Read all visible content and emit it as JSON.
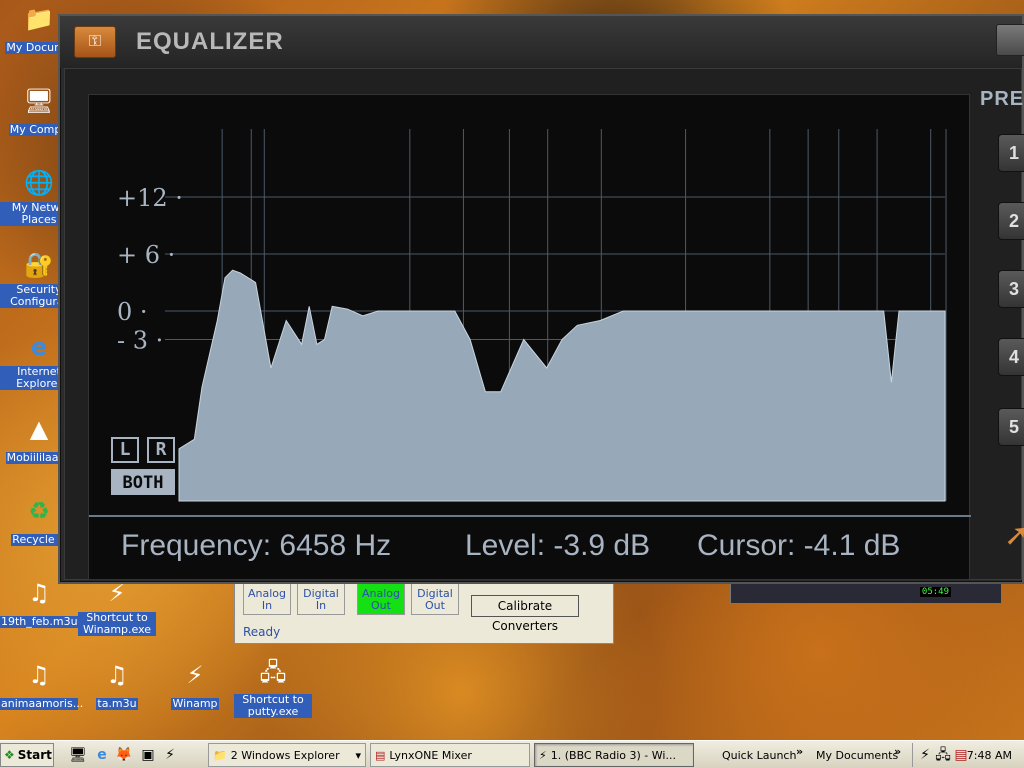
{
  "desktop": {
    "icons": [
      {
        "label": "My Docume",
        "glyph": "📁"
      },
      {
        "label": "My Compu",
        "glyph": "🖥"
      },
      {
        "label": "My Netwo Places",
        "glyph": "🌐"
      },
      {
        "label": "Security Configurat",
        "glyph": "🔐"
      },
      {
        "label": "Internet Explorer",
        "glyph": "e"
      },
      {
        "label": "Mobiililaajal",
        "glyph": "▲"
      },
      {
        "label": "Recycle B",
        "glyph": "♻"
      },
      {
        "label": "19th_feb.m3u",
        "glyph": "♫"
      },
      {
        "label": "Shortcut to Winamp.exe",
        "glyph": "⚡"
      },
      {
        "label": "animaamoris...",
        "glyph": "♫"
      },
      {
        "label": "ta.m3u",
        "glyph": "♫"
      },
      {
        "label": "Winamp",
        "glyph": "⚡"
      },
      {
        "label": "Shortcut to putty.exe",
        "glyph": "🖧"
      }
    ]
  },
  "mixer": {
    "buttons": [
      "Analog In",
      "Digital In",
      "Analog Out",
      "Digital Out"
    ],
    "active_index": 2,
    "calibrate_label": "Calibrate Converters",
    "status": "Ready"
  },
  "winamp_mini": {
    "time": "05:49"
  },
  "equalizer": {
    "title": "EQUALIZER",
    "presets_label": "PRE",
    "preset_buttons": [
      "1",
      "2",
      "3",
      "4",
      "5"
    ],
    "channel_buttons": {
      "left": "L",
      "right": "R",
      "both": "BOTH"
    },
    "active_channel": "both",
    "y_ticks": [
      "+12",
      "+ 6",
      "0",
      "- 3"
    ],
    "readout": {
      "frequency": "Frequency:  6458 Hz",
      "level": "Level: -3.9 dB",
      "cursor": "Cursor: -4.1 dB"
    },
    "colors": {
      "curve": "#97a9b8",
      "grid": "#4c5a68",
      "text": "#a8b4c2",
      "background": "#0b0b0c"
    }
  },
  "chart_data": {
    "type": "area",
    "y_tick_labels": [
      "+12",
      "+ 6",
      "0",
      "- 3"
    ],
    "y_tick_values": [
      12,
      6,
      0,
      -3
    ],
    "ylim": [
      -15,
      15
    ],
    "x": [
      0,
      2,
      3,
      5,
      6,
      7,
      8,
      10,
      12,
      14,
      16,
      17,
      18,
      19,
      20,
      22,
      24,
      26,
      27,
      28,
      30,
      33,
      36,
      38,
      40,
      42,
      45,
      48,
      50,
      52,
      55,
      58,
      60,
      62,
      65,
      70,
      72,
      75,
      80,
      84,
      88,
      90,
      91,
      92,
      93,
      94,
      95,
      97,
      100
    ],
    "values": [
      -14.5,
      -13.5,
      -8,
      -1,
      3.5,
      4.3,
      4,
      3,
      -6,
      -1,
      -3.5,
      0.5,
      -3.5,
      -3,
      0.5,
      0.2,
      -0.5,
      0,
      0,
      0,
      0,
      0,
      0,
      -3,
      -8.5,
      -8.5,
      -3,
      -6,
      -3,
      -1.5,
      -1,
      0,
      0,
      0,
      0,
      0,
      0,
      0,
      0,
      0,
      0,
      0,
      0,
      0,
      -7.5,
      0,
      0,
      0,
      0
    ]
  },
  "taskbar": {
    "start_label": "Start",
    "quicklaunch_icons": [
      "🖥",
      "e",
      "🦊",
      "▣",
      "⚡"
    ],
    "tasks": [
      {
        "label": "2 Windows Explorer",
        "icon": "📁"
      },
      {
        "label": "LynxONE Mixer",
        "icon": "▤"
      },
      {
        "label": "1. (BBC Radio 3) - Wi...",
        "icon": "⚡"
      }
    ],
    "active_task": 2,
    "quick_launch_label": "Quick Launch",
    "my_documents_label": "My Documents",
    "clock": "7:48 AM"
  }
}
